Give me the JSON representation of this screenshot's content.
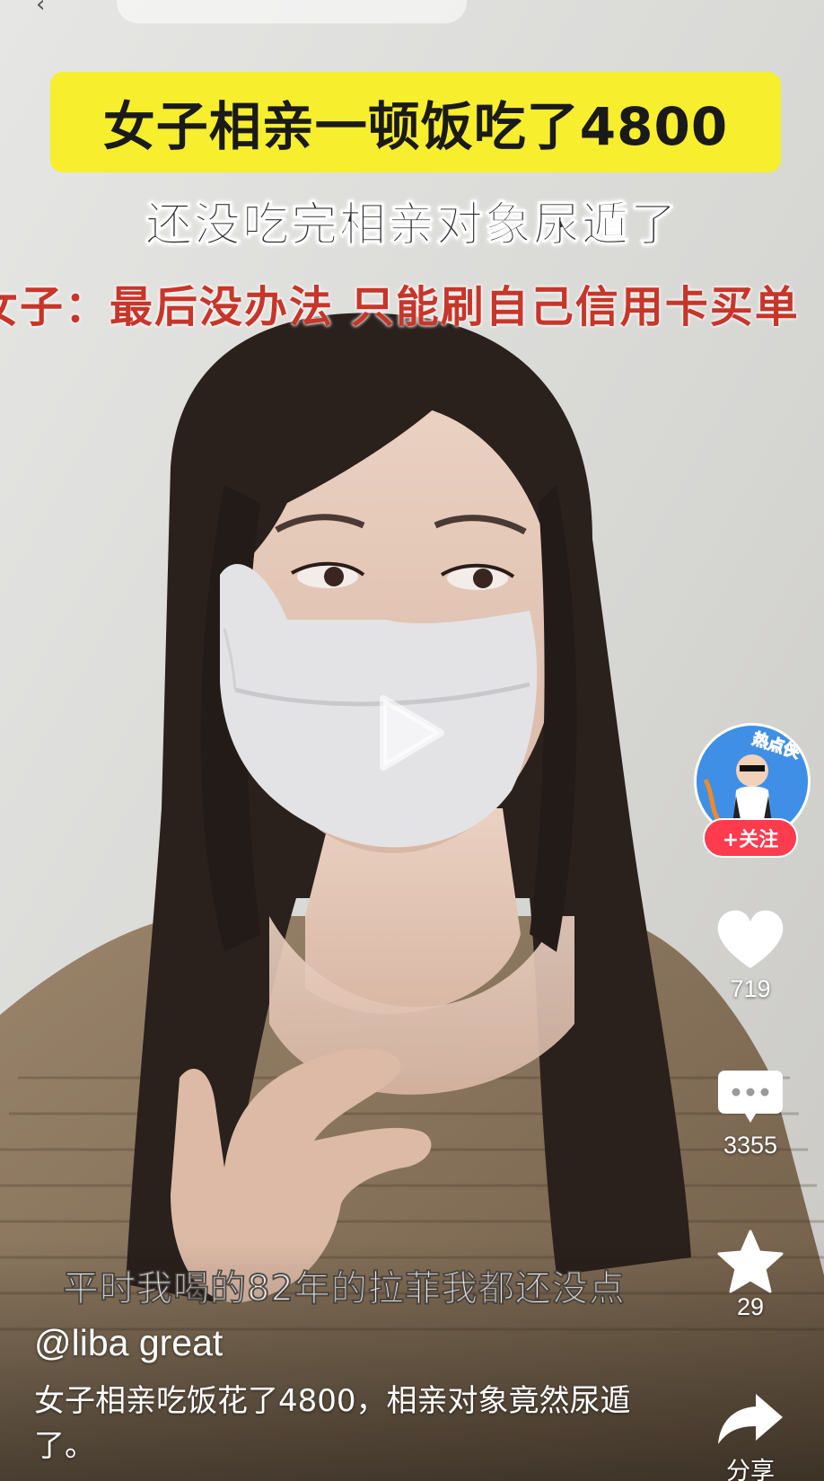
{
  "video": {
    "title_banner": "女子相亲一顿饭吃了4800",
    "subtitle_line_1": "还没吃完相亲对象尿遁了",
    "subtitle_line_2": "女子：最后没办法 只能刷自己信用卡买单",
    "spoken_caption": "平时我喝的82年的拉菲我都还没点"
  },
  "author": {
    "handle": "@liba great",
    "avatar_text": "热点侠",
    "follow_label": "+关注"
  },
  "description": "女子相亲吃饭花了4800，相亲对象竟然尿遁了。",
  "actions": {
    "likes": "719",
    "comments": "3355",
    "favorites": "29",
    "share_label": "分享"
  },
  "colors": {
    "banner": "#f7ee2e",
    "subtitle_red": "#c7362a",
    "follow": "#ff3b4e"
  },
  "icons": [
    "play-icon",
    "heart-icon",
    "comment-icon",
    "star-icon",
    "share-icon"
  ]
}
